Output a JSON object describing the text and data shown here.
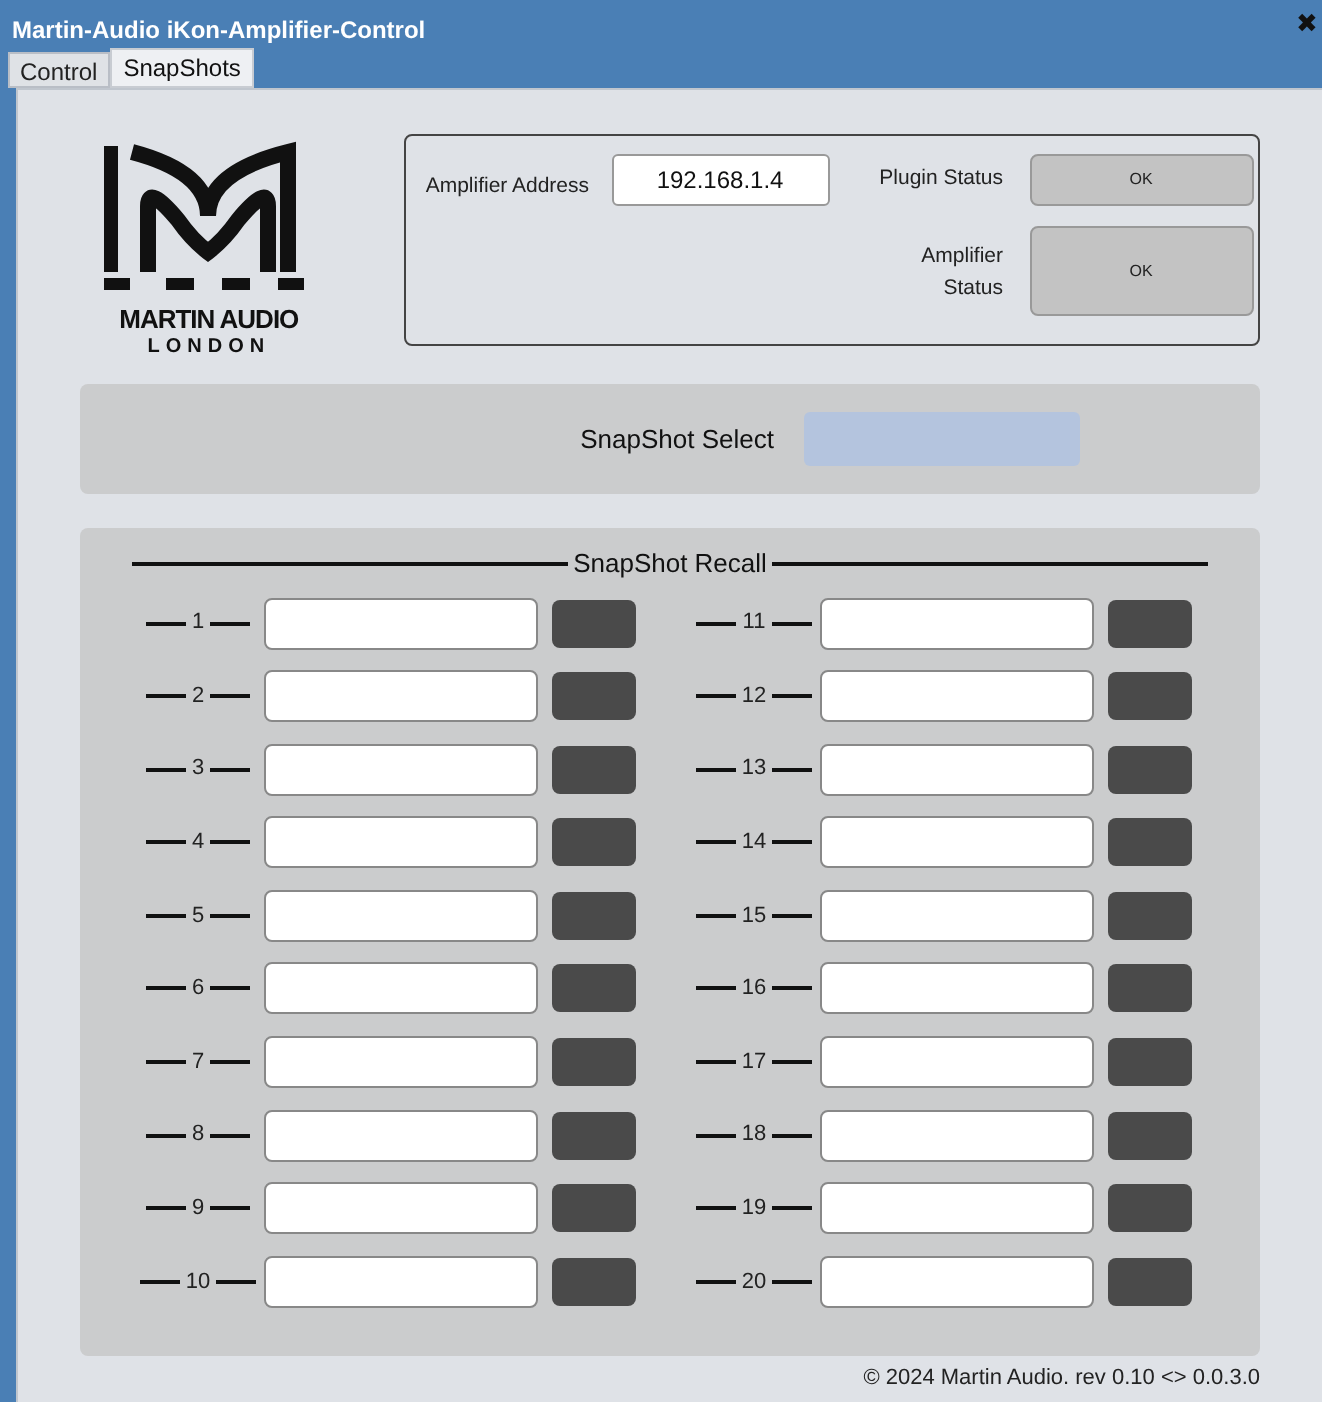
{
  "window": {
    "title": "Martin-Audio iKon-Amplifier-Control",
    "close": "✖"
  },
  "tabs": [
    {
      "label": "Control",
      "selected": false
    },
    {
      "label": "SnapShots",
      "selected": true
    }
  ],
  "logo": {
    "line_1": "MARTIN AUDIO",
    "line_2": "LONDON"
  },
  "status": {
    "address_label": "Amplifier Address",
    "address_value": "192.168.1.4",
    "plugin_label": "Plugin Status",
    "plugin_value": "OK",
    "amp_label": "Amplifier Status",
    "amp_value": "OK"
  },
  "snapshot_select": {
    "label": "SnapShot Select"
  },
  "snapshot_recall": {
    "title": "SnapShot Recall",
    "slots": [
      {
        "number": "1"
      },
      {
        "number": "2"
      },
      {
        "number": "3"
      },
      {
        "number": "4"
      },
      {
        "number": "5"
      },
      {
        "number": "6"
      },
      {
        "number": "7"
      },
      {
        "number": "8"
      },
      {
        "number": "9"
      },
      {
        "number": "10"
      },
      {
        "number": "11"
      },
      {
        "number": "12"
      },
      {
        "number": "13"
      },
      {
        "number": "14"
      },
      {
        "number": "15"
      },
      {
        "number": "16"
      },
      {
        "number": "17"
      },
      {
        "number": "18"
      },
      {
        "number": "19"
      },
      {
        "number": "20"
      }
    ]
  },
  "footer": "© 2024 Martin Audio. rev 0.10 <> 0.0.3.0"
}
